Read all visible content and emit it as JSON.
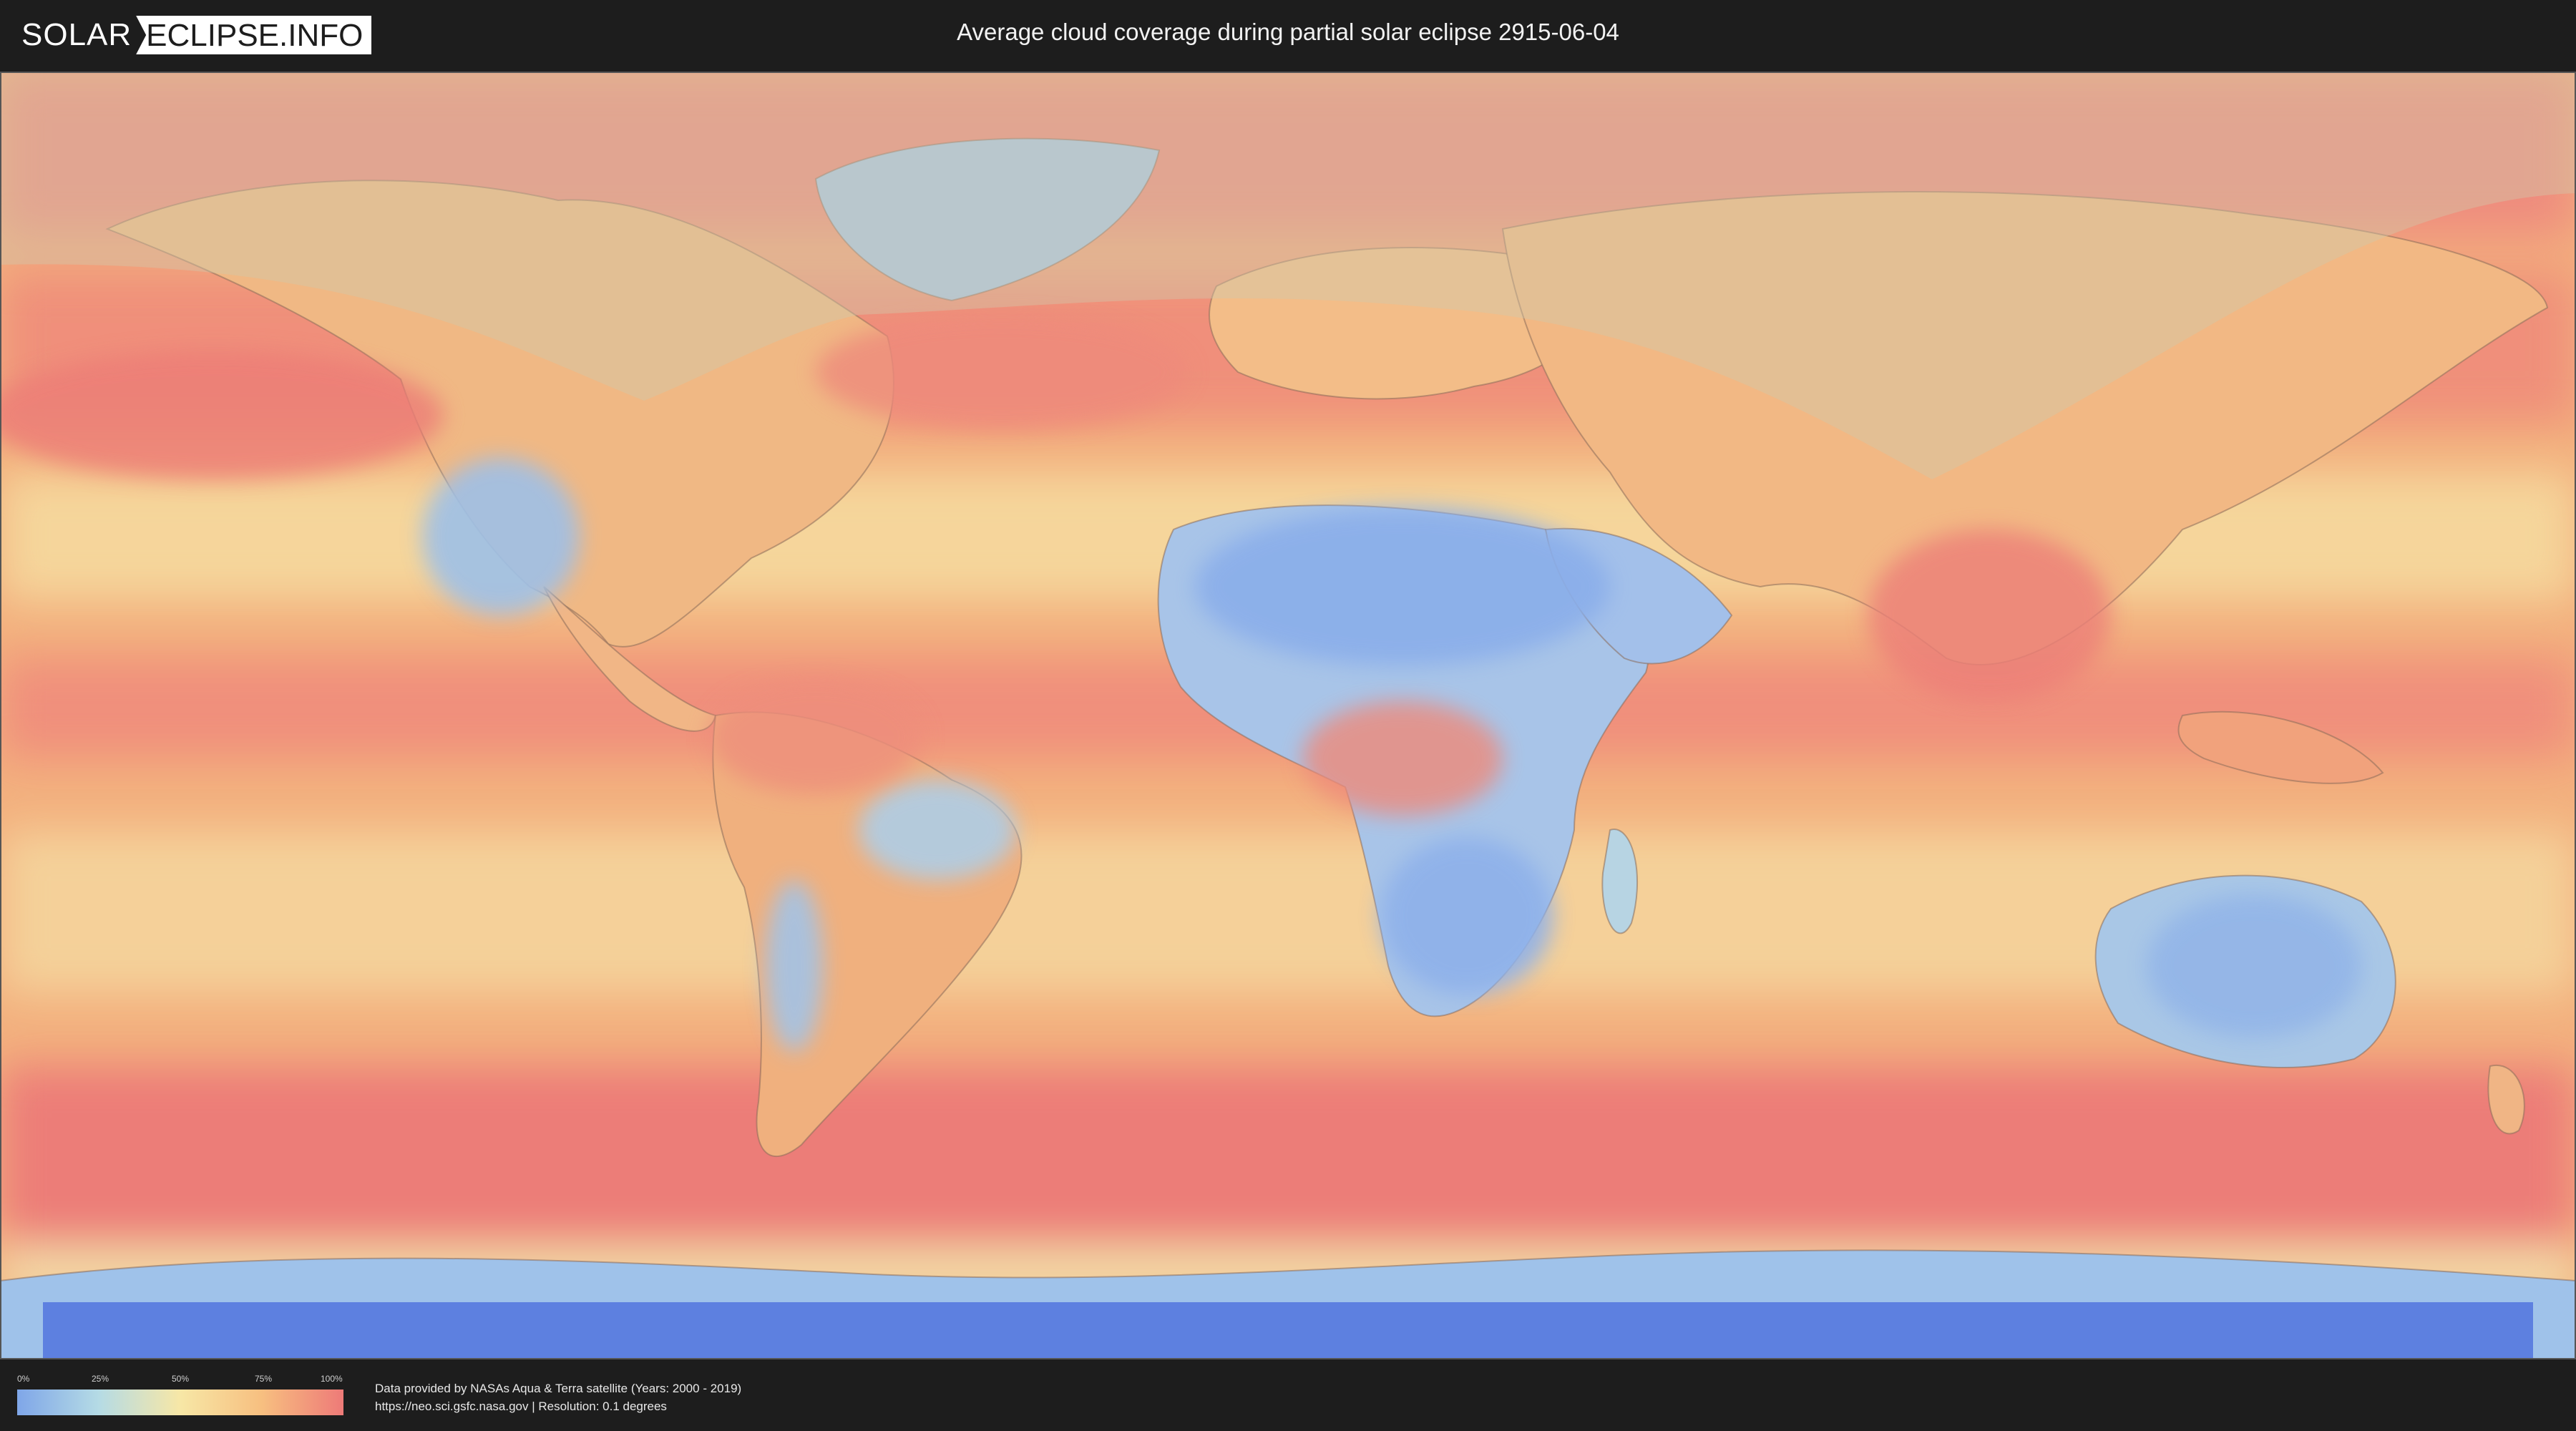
{
  "header": {
    "logo": {
      "part1": "SOLAR",
      "part2": "ECLIPSE.INFO"
    },
    "title": "Average cloud coverage during partial solar eclipse 2915-06-04"
  },
  "legend": {
    "ticks": [
      "0%",
      "25%",
      "50%",
      "75%",
      "100%"
    ],
    "colors": [
      "#7fa6e8",
      "#b5dbe5",
      "#f7e7a6",
      "#f7bf80",
      "#ee7a78"
    ]
  },
  "credit": {
    "line1": "Data provided by NASAs Aqua & Terra satellite (Years: 2000 - 2019)",
    "line2": "https://neo.sci.gsfc.nasa.gov | Resolution: 0.1 degrees"
  },
  "map": {
    "projection": "equirectangular",
    "palette": {
      "clear": "#7fa6e8",
      "low": "#b5dbe5",
      "mid": "#f7e7a6",
      "high": "#f7bf80",
      "overcast": "#ee7a78",
      "polar": "#5c7fe0"
    },
    "eclipse_zone_color": "#c9c2a8"
  }
}
